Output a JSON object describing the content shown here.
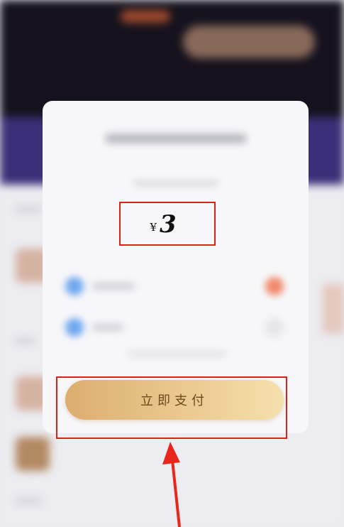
{
  "payment_dialog": {
    "amount": {
      "currency_symbol": "¥",
      "value": "3"
    },
    "pay_button_label": "立即支付"
  },
  "annotations": {
    "highlight_color": "#d8231b",
    "arrow_color": "#e8261c"
  },
  "colors": {
    "button_gradient_start": "#dcae6f",
    "button_gradient_end": "#f5e0ad",
    "button_text": "#6b4a1e"
  }
}
